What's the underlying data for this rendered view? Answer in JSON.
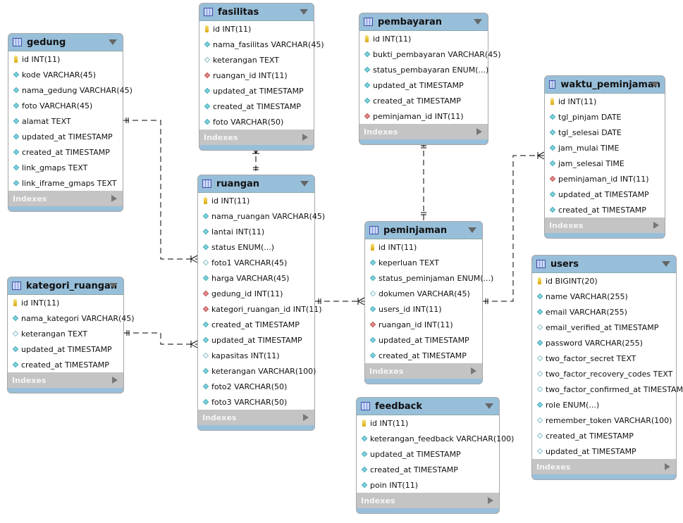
{
  "indexes_label": "Indexes",
  "colors": {
    "header": "#98bfda",
    "indexes": "#c4c4c4",
    "line": "#000000"
  },
  "field_icon_legend": {
    "pk": "key-icon",
    "nn": "filled-diamond-icon",
    "nul": "hollow-diamond-icon",
    "fk": "red-diamond-icon"
  },
  "tables": [
    {
      "id": "gedung",
      "name": "gedung",
      "fields": [
        {
          "text": "id INT(11)",
          "icon": "pk"
        },
        {
          "text": "kode VARCHAR(45)",
          "icon": "nn"
        },
        {
          "text": "nama_gedung VARCHAR(45)",
          "icon": "nn"
        },
        {
          "text": "foto VARCHAR(45)",
          "icon": "nn"
        },
        {
          "text": "alamat TEXT",
          "icon": "nn"
        },
        {
          "text": "updated_at TIMESTAMP",
          "icon": "nn"
        },
        {
          "text": "created_at TIMESTAMP",
          "icon": "nn"
        },
        {
          "text": "link_gmaps TEXT",
          "icon": "nn"
        },
        {
          "text": "link_iframe_gmaps TEXT",
          "icon": "nn"
        }
      ]
    },
    {
      "id": "fasilitas",
      "name": "fasilitas",
      "fields": [
        {
          "text": "id INT(11)",
          "icon": "pk"
        },
        {
          "text": "nama_fasilitas VARCHAR(45)",
          "icon": "nn"
        },
        {
          "text": "keterangan TEXT",
          "icon": "nul"
        },
        {
          "text": "ruangan_id INT(11)",
          "icon": "fk"
        },
        {
          "text": "updated_at TIMESTAMP",
          "icon": "nn"
        },
        {
          "text": "created_at TIMESTAMP",
          "icon": "nn"
        },
        {
          "text": "foto VARCHAR(50)",
          "icon": "nn"
        }
      ]
    },
    {
      "id": "pembayaran",
      "name": "pembayaran",
      "fields": [
        {
          "text": "id INT(11)",
          "icon": "pk"
        },
        {
          "text": "bukti_pembayaran VARCHAR(45)",
          "icon": "nn"
        },
        {
          "text": "status_pembayaran ENUM(...)",
          "icon": "nn"
        },
        {
          "text": "updated_at TIMESTAMP",
          "icon": "nn"
        },
        {
          "text": "created_at TIMESTAMP",
          "icon": "nn"
        },
        {
          "text": "peminjaman_id INT(11)",
          "icon": "fk"
        }
      ]
    },
    {
      "id": "waktu_peminjaman",
      "name": "waktu_peminjaman",
      "fields": [
        {
          "text": "id INT(11)",
          "icon": "pk"
        },
        {
          "text": "tgl_pinjam DATE",
          "icon": "nn"
        },
        {
          "text": "tgl_selesai DATE",
          "icon": "nn"
        },
        {
          "text": "jam_mulai TIME",
          "icon": "nn"
        },
        {
          "text": "jam_selesai TIME",
          "icon": "nn"
        },
        {
          "text": "peminjaman_id INT(11)",
          "icon": "fk"
        },
        {
          "text": "updated_at TIMESTAMP",
          "icon": "nn"
        },
        {
          "text": "created_at TIMESTAMP",
          "icon": "nn"
        }
      ]
    },
    {
      "id": "ruangan",
      "name": "ruangan",
      "fields": [
        {
          "text": "id INT(11)",
          "icon": "pk"
        },
        {
          "text": "nama_ruangan VARCHAR(45)",
          "icon": "nn"
        },
        {
          "text": "lantai INT(11)",
          "icon": "nn"
        },
        {
          "text": "status ENUM(...)",
          "icon": "nn"
        },
        {
          "text": "foto1 VARCHAR(45)",
          "icon": "nul"
        },
        {
          "text": "harga VARCHAR(45)",
          "icon": "nn"
        },
        {
          "text": "gedung_id INT(11)",
          "icon": "fk"
        },
        {
          "text": "kategori_ruangan_id INT(11)",
          "icon": "fk"
        },
        {
          "text": "created_at TIMESTAMP",
          "icon": "nn"
        },
        {
          "text": "updated_at TIMESTAMP",
          "icon": "nn"
        },
        {
          "text": "kapasitas INT(11)",
          "icon": "nul"
        },
        {
          "text": "keterangan VARCHAR(100)",
          "icon": "nn"
        },
        {
          "text": "foto2 VARCHAR(50)",
          "icon": "nn"
        },
        {
          "text": "foto3 VARCHAR(50)",
          "icon": "nn"
        }
      ]
    },
    {
      "id": "peminjaman",
      "name": "peminjaman",
      "fields": [
        {
          "text": "id INT(11)",
          "icon": "pk"
        },
        {
          "text": "keperluan TEXT",
          "icon": "nn"
        },
        {
          "text": "status_peminjaman ENUM(...)",
          "icon": "nn"
        },
        {
          "text": "dokumen VARCHAR(45)",
          "icon": "nul"
        },
        {
          "text": "users_id INT(11)",
          "icon": "nn"
        },
        {
          "text": "ruangan_id INT(11)",
          "icon": "fk"
        },
        {
          "text": "updated_at TIMESTAMP",
          "icon": "nn"
        },
        {
          "text": "created_at TIMESTAMP",
          "icon": "nn"
        }
      ]
    },
    {
      "id": "users",
      "name": "users",
      "fields": [
        {
          "text": "id BIGINT(20)",
          "icon": "pk"
        },
        {
          "text": "name VARCHAR(255)",
          "icon": "nn"
        },
        {
          "text": "email VARCHAR(255)",
          "icon": "nn"
        },
        {
          "text": "email_verified_at TIMESTAMP",
          "icon": "nul"
        },
        {
          "text": "password VARCHAR(255)",
          "icon": "nn"
        },
        {
          "text": "two_factor_secret TEXT",
          "icon": "nul"
        },
        {
          "text": "two_factor_recovery_codes TEXT",
          "icon": "nul"
        },
        {
          "text": "two_factor_confirmed_at TIMESTAMP",
          "icon": "nul"
        },
        {
          "text": "role ENUM(...)",
          "icon": "nn"
        },
        {
          "text": "remember_token VARCHAR(100)",
          "icon": "nul"
        },
        {
          "text": "created_at TIMESTAMP",
          "icon": "nul"
        },
        {
          "text": "updated_at TIMESTAMP",
          "icon": "nul"
        }
      ]
    },
    {
      "id": "kategori_ruangan",
      "name": "kategori_ruangan",
      "fields": [
        {
          "text": "id INT(11)",
          "icon": "pk"
        },
        {
          "text": "nama_kategori VARCHAR(45)",
          "icon": "nn"
        },
        {
          "text": "keterangan TEXT",
          "icon": "nul"
        },
        {
          "text": "updated_at TIMESTAMP",
          "icon": "nn"
        },
        {
          "text": "created_at TIMESTAMP",
          "icon": "nn"
        }
      ]
    },
    {
      "id": "feedback",
      "name": "feedback",
      "fields": [
        {
          "text": "id INT(11)",
          "icon": "pk"
        },
        {
          "text": "keterangan_feedback VARCHAR(100)",
          "icon": "nn"
        },
        {
          "text": "updated_at TIMESTAMP",
          "icon": "nn"
        },
        {
          "text": "created_at TIMESTAMP",
          "icon": "nn"
        },
        {
          "text": "poin INT(11)",
          "icon": "nn"
        }
      ]
    }
  ],
  "relationships": [
    {
      "from": "gedung",
      "to": "ruangan",
      "from_end": "one",
      "to_end": "many"
    },
    {
      "from": "kategori_ruangan",
      "to": "ruangan",
      "from_end": "one",
      "to_end": "many"
    },
    {
      "from": "ruangan",
      "to": "fasilitas",
      "from_end": "one",
      "to_end": "many"
    },
    {
      "from": "ruangan",
      "to": "peminjaman",
      "from_end": "one",
      "to_end": "many"
    },
    {
      "from": "peminjaman",
      "to": "pembayaran",
      "from_end": "one",
      "to_end": "one"
    },
    {
      "from": "peminjaman",
      "to": "waktu_peminjaman",
      "from_end": "one",
      "to_end": "many"
    }
  ]
}
